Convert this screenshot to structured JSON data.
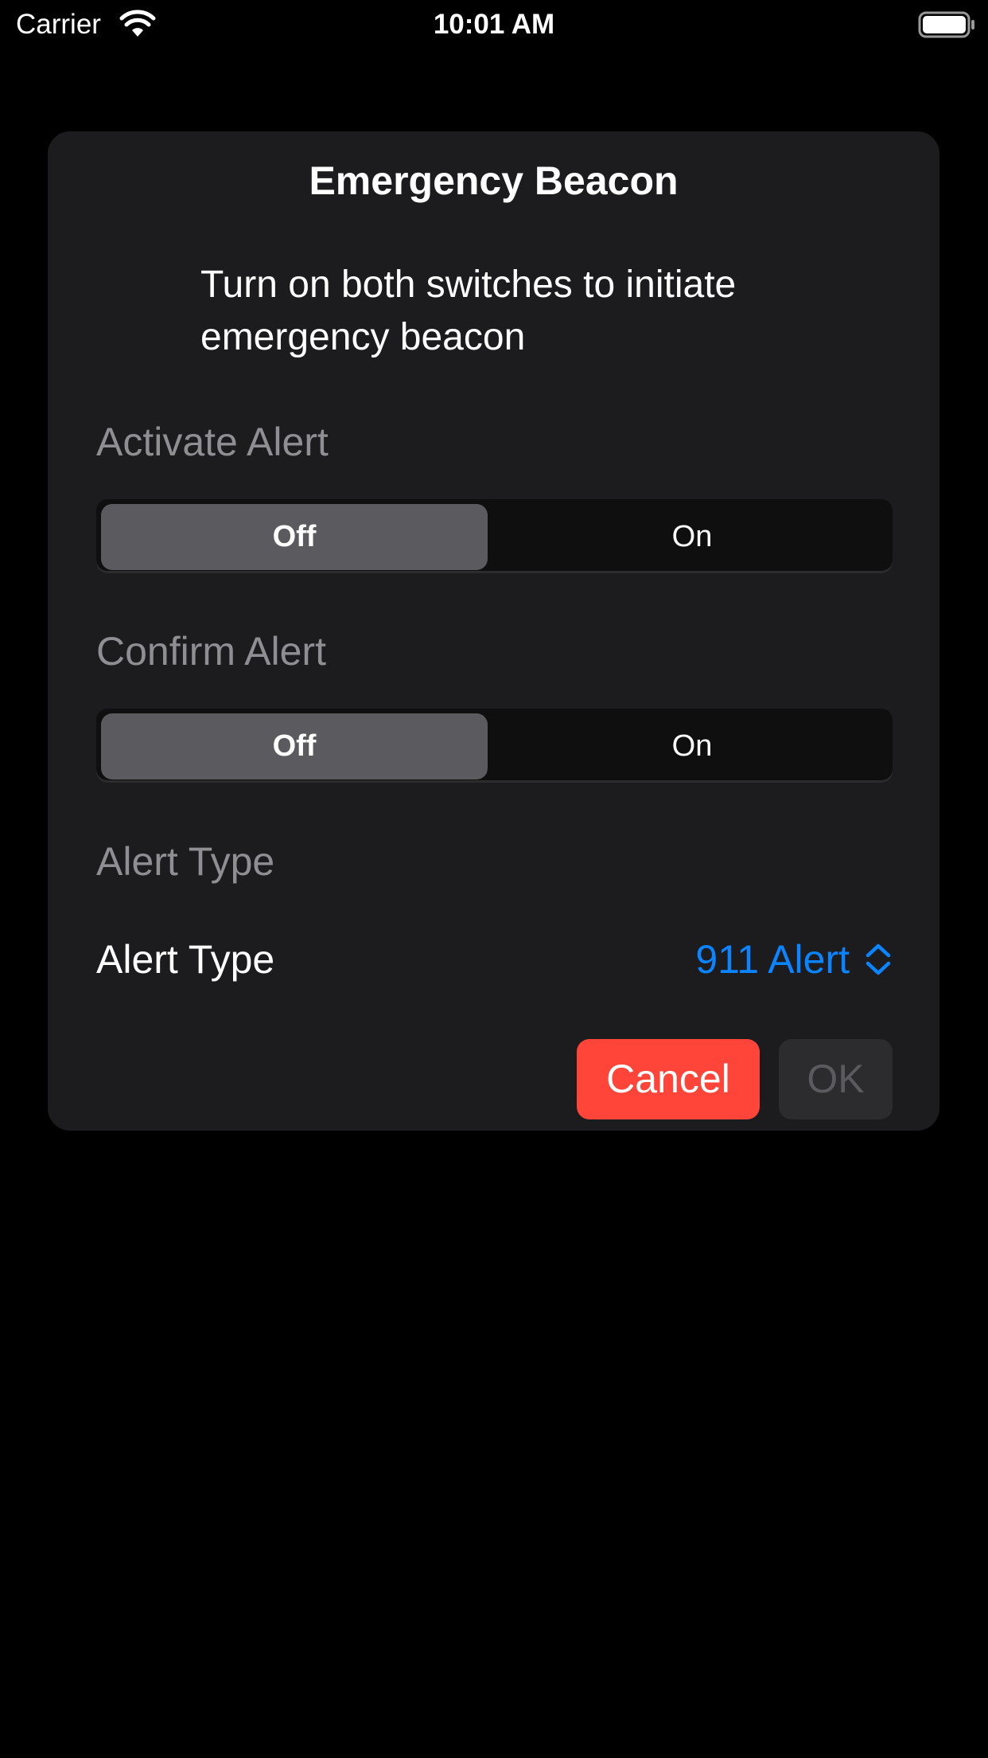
{
  "status_bar": {
    "carrier": "Carrier",
    "time": "10:01 AM",
    "wifi_icon": "wifi-icon",
    "battery_icon": "battery-icon"
  },
  "dialog": {
    "title": "Emergency Beacon",
    "message": "Turn on both switches to initiate emergency beacon",
    "activate_alert": {
      "label": "Activate Alert",
      "options": [
        "Off",
        "On"
      ],
      "selected": "Off"
    },
    "confirm_alert": {
      "label": "Confirm Alert",
      "options": [
        "Off",
        "On"
      ],
      "selected": "Off"
    },
    "alert_type_section": {
      "label": "Alert Type"
    },
    "alert_type_picker": {
      "label": "Alert Type",
      "value": "911 Alert",
      "icon": "chevron-up-down-icon"
    },
    "buttons": {
      "cancel": "Cancel",
      "ok": "OK"
    }
  },
  "colors": {
    "background": "#000000",
    "card": "#1c1c1e",
    "accent": "#0a84ff",
    "destructive": "#ff453a",
    "secondary_text": "#8e8e93",
    "segment_selected": "#5a5a5f"
  }
}
